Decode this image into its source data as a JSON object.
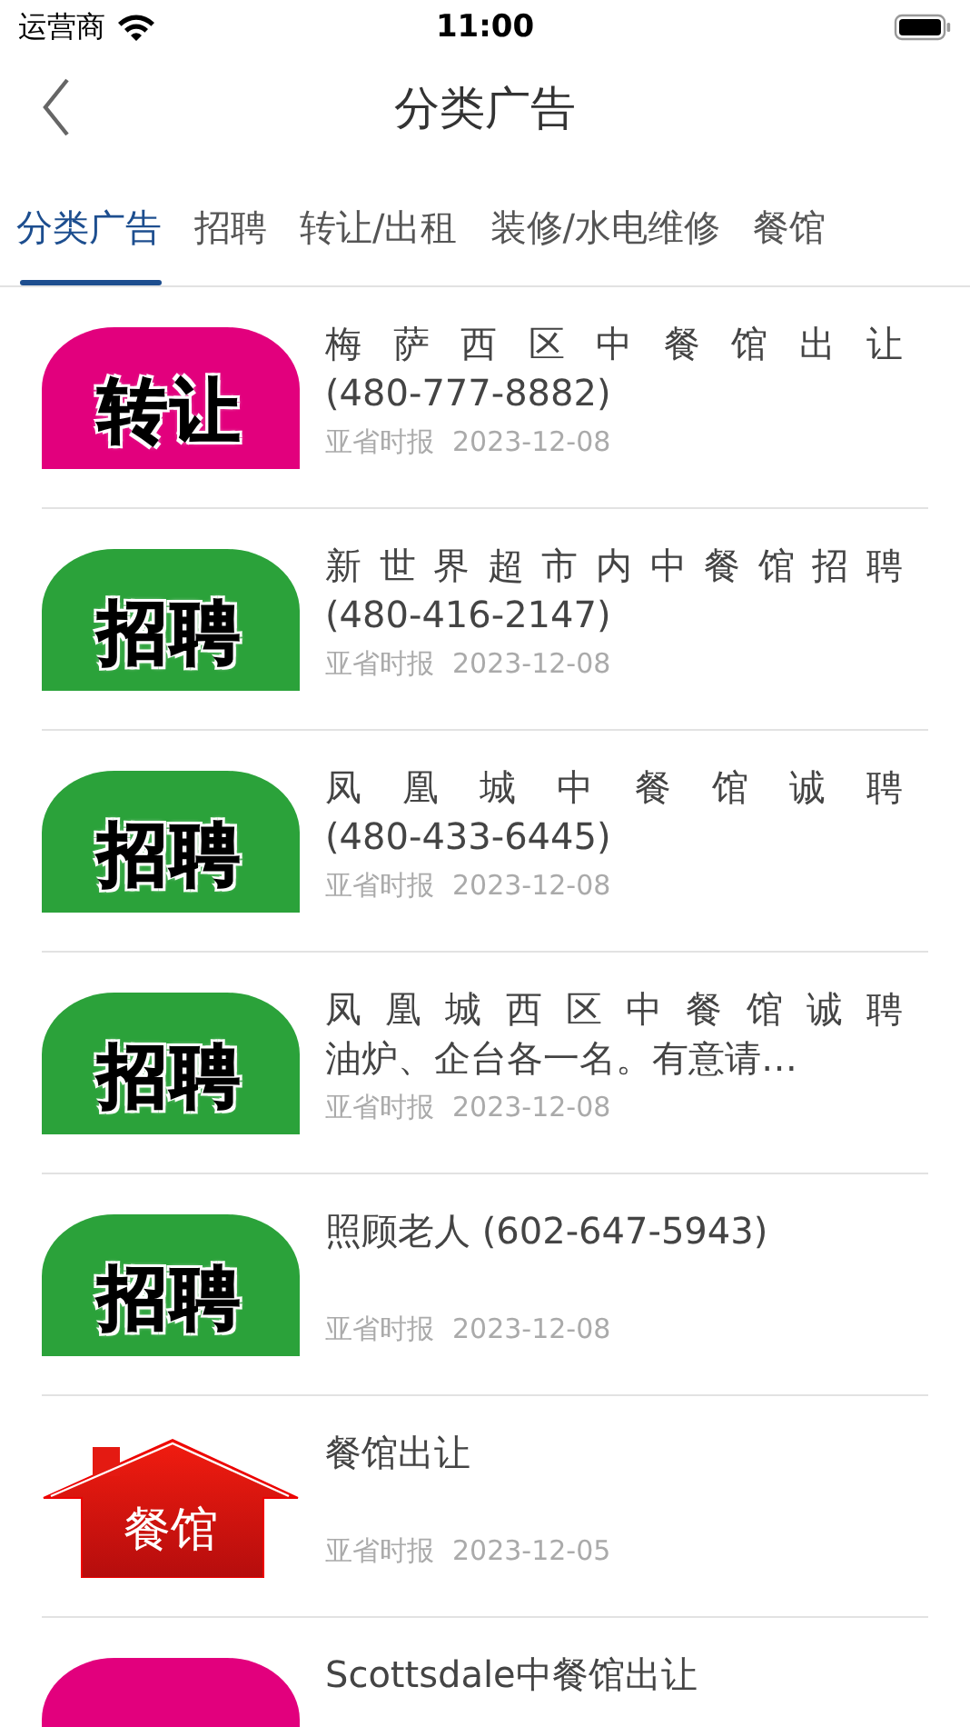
{
  "status_bar": {
    "carrier": "运营商",
    "time": "11:00"
  },
  "nav": {
    "title": "分类广告"
  },
  "tabs": [
    {
      "label": "分类广告",
      "selected": true
    },
    {
      "label": "招聘",
      "selected": false
    },
    {
      "label": "转让/出租",
      "selected": false
    },
    {
      "label": "装修/水电维修",
      "selected": false
    },
    {
      "label": "餐馆",
      "selected": false
    }
  ],
  "items": [
    {
      "thumb": {
        "kind": "pink",
        "text": "转让"
      },
      "title": [
        "梅萨西区中餐馆出让",
        "(480-777-8882)"
      ],
      "source": "亚省时报",
      "date": "2023-12-08"
    },
    {
      "thumb": {
        "kind": "green",
        "text": "招聘"
      },
      "title": [
        "新世界超市内中餐馆招聘",
        "(480-416-2147)"
      ],
      "source": "亚省时报",
      "date": "2023-12-08"
    },
    {
      "thumb": {
        "kind": "green",
        "text": "招聘"
      },
      "title": [
        "凤凰城中餐馆诚聘",
        "(480-433-6445)"
      ],
      "source": "亚省时报",
      "date": "2023-12-08"
    },
    {
      "thumb": {
        "kind": "green",
        "text": "招聘"
      },
      "title": [
        "凤凰城西区中餐馆诚聘",
        "油炉、企台各一名。有意请…"
      ],
      "source": "亚省时报",
      "date": "2023-12-08"
    },
    {
      "thumb": {
        "kind": "green",
        "text": "招聘"
      },
      "title": [
        "照顾老人 (602-647-5943)"
      ],
      "source": "亚省时报",
      "date": "2023-12-08"
    },
    {
      "thumb": {
        "kind": "house",
        "text": "餐馆"
      },
      "title": [
        "餐馆出让"
      ],
      "source": "亚省时报",
      "date": "2023-12-05"
    },
    {
      "thumb": {
        "kind": "pink"
      },
      "title": [
        "Scottsdale中餐馆出让"
      ]
    }
  ]
}
